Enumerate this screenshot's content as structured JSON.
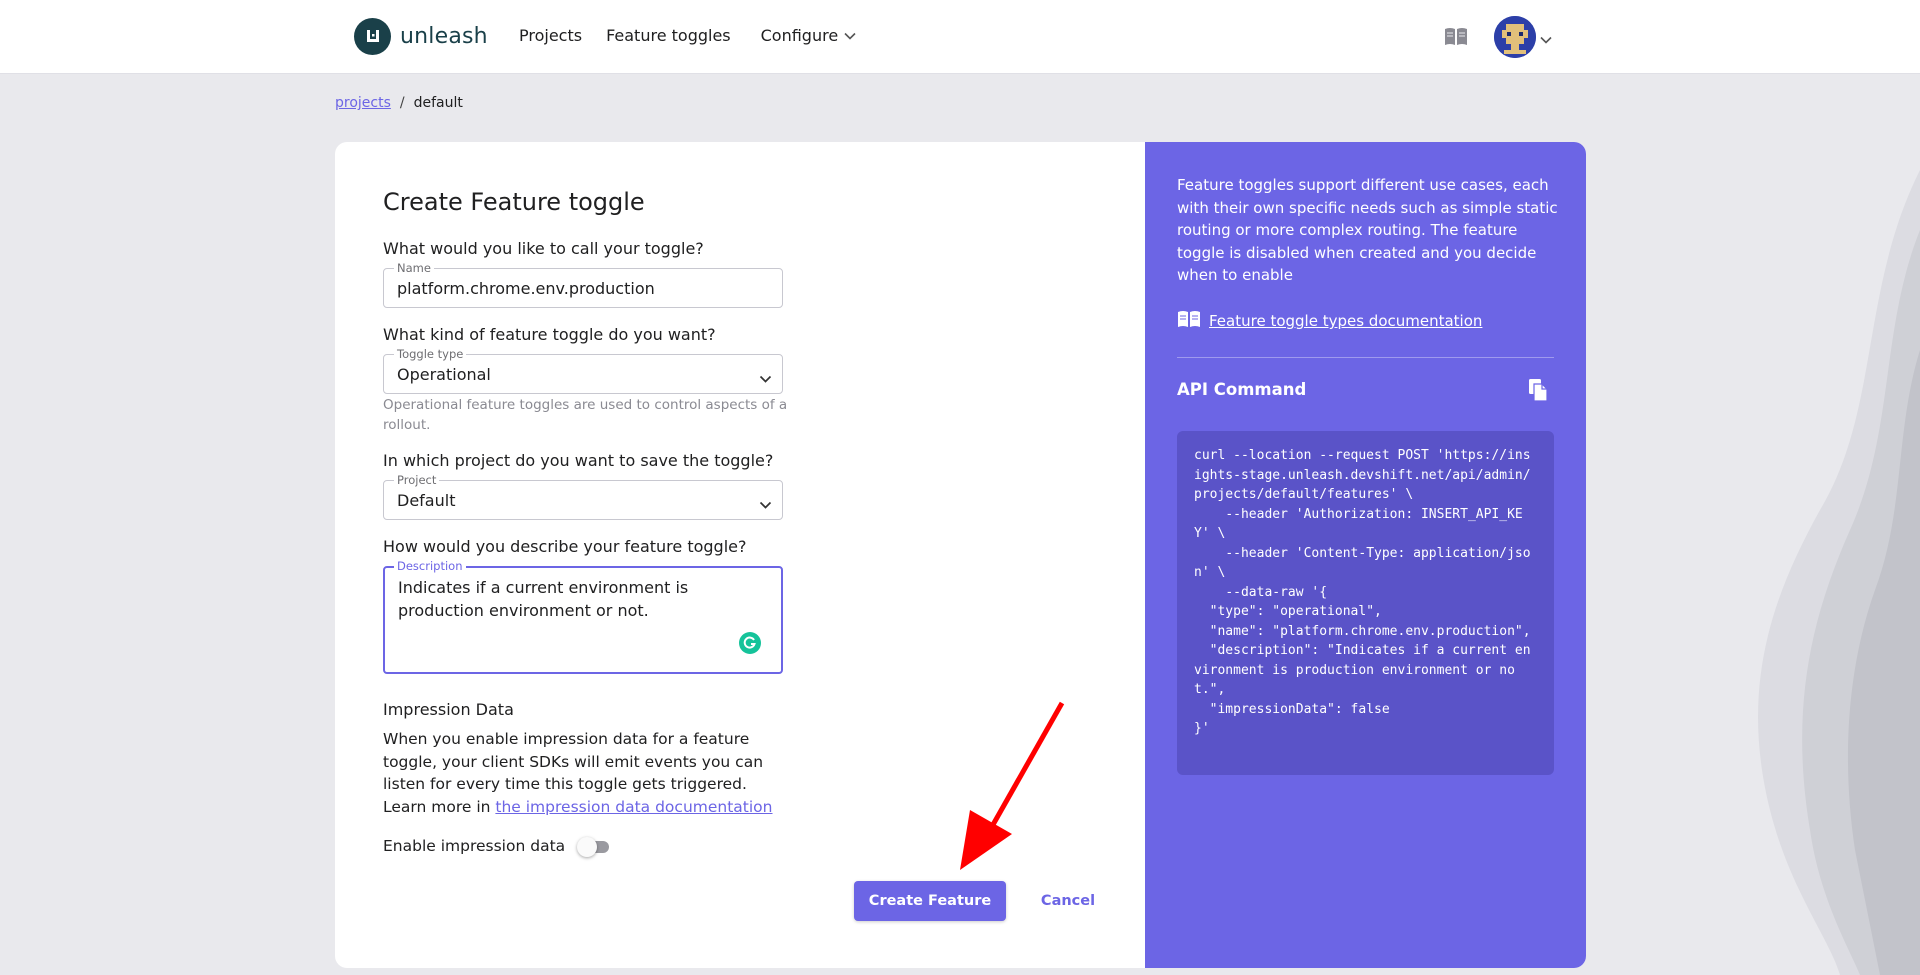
{
  "topbar": {
    "logo_text": "unleash",
    "nav": [
      {
        "label": "Projects"
      },
      {
        "label": "Feature toggles"
      },
      {
        "label": "Configure"
      }
    ]
  },
  "breadcrumb": {
    "parent": "projects",
    "separator": "/",
    "current": "default"
  },
  "form": {
    "title": "Create Feature toggle",
    "name_question": "What would you like to call your toggle?",
    "name_legend": "Name",
    "name_value": "platform.chrome.env.production",
    "type_question": "What kind of feature toggle do you want?",
    "type_legend": "Toggle type",
    "type_value": "Operational",
    "type_helper": "Operational feature toggles are used to control aspects of a rollout.",
    "project_question": "In which project do you want to save the toggle?",
    "project_legend": "Project",
    "project_value": "Default",
    "description_question": "How would you describe your feature toggle?",
    "description_legend": "Description",
    "description_value": "Indicates if a current environment is production environment or not.",
    "impression_title": "Impression Data",
    "impression_desc": "When you enable impression data for a feature toggle, your client SDKs will emit events you can listen for every time this toggle gets triggered. Learn more in ",
    "impression_link": "the impression data documentation",
    "impression_toggle_label": "Enable impression data",
    "impression_enabled": false,
    "create_label": "Create Feature",
    "cancel_label": "Cancel"
  },
  "side": {
    "description": "Feature toggles support different use cases, each with their own specific needs such as simple static routing or more complex routing. The feature toggle is disabled when created and you decide when to enable",
    "doc_link": "Feature toggle types documentation",
    "api_title": "API Command",
    "code": "curl --location --request POST 'https://insights-stage.unleash.devshift.net/api/admin/projects/default/features' \\\n    --header 'Authorization: INSERT_API_KEY' \\\n    --header 'Content-Type: application/json' \\\n    --data-raw '{\n  \"type\": \"operational\",\n  \"name\": \"platform.chrome.env.production\",\n  \"description\": \"Indicates if a current environment is production environment or not.\",\n  \"impressionData\": false\n}'"
  },
  "icons": {
    "logo": "unleash-logo-icon",
    "docs": "book-icon",
    "copy": "copy-icon",
    "grammarly": "grammarly-icon"
  },
  "colors": {
    "accent": "#6c65e5",
    "side_panel": "#6c65e5",
    "code_bg": "#5a53c8",
    "logo": "#1a4049",
    "annotation_arrow": "#ff0000"
  }
}
